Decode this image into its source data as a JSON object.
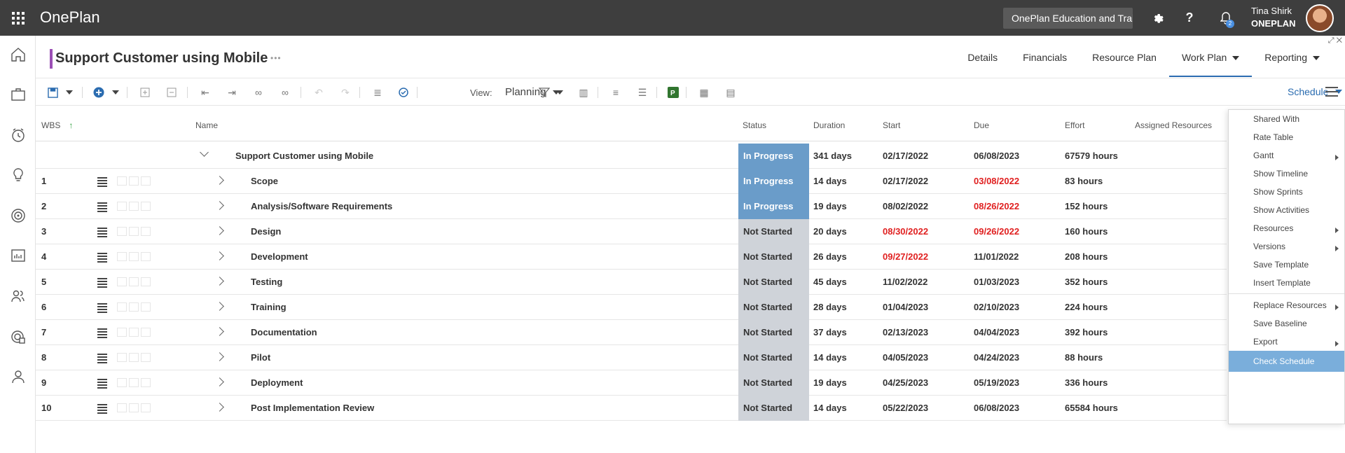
{
  "app": {
    "name": "OnePlan",
    "tenant": "OnePlan Education and Training"
  },
  "user": {
    "name": "Tina Shirk",
    "org": "ONEPLAN",
    "notification_count": "2"
  },
  "topbar": {
    "help_label": "?"
  },
  "page": {
    "title": "Support Customer using Mobile",
    "more": "•••"
  },
  "tabs": [
    {
      "label": "Details"
    },
    {
      "label": "Financials"
    },
    {
      "label": "Resource Plan"
    },
    {
      "label": "Work Plan",
      "active": true
    },
    {
      "label": "Reporting"
    }
  ],
  "toolbar": {
    "view_label": "View:",
    "view_value": "Planning",
    "schedule_label": "Schedule"
  },
  "columns": {
    "wbs": "WBS",
    "name": "Name",
    "status": "Status",
    "duration": "Duration",
    "start": "Start",
    "due": "Due",
    "effort": "Effort",
    "assigned": "Assigned Resources"
  },
  "summary": {
    "name": "Support Customer using Mobile",
    "status": "In Progress",
    "duration": "341 days",
    "start": "02/17/2022",
    "due": "06/08/2023",
    "effort": "67579 hours"
  },
  "rows": [
    {
      "wbs": "1",
      "name": "Scope",
      "status": "In Progress",
      "duration": "14 days",
      "start": "02/17/2022",
      "due": "03/08/2022",
      "effort": "83 hours"
    },
    {
      "wbs": "2",
      "name": "Analysis/Software Requirements",
      "status": "In Progress",
      "duration": "19 days",
      "start": "08/02/2022",
      "due": "08/26/2022",
      "effort": "152 hours"
    },
    {
      "wbs": "3",
      "name": "Design",
      "status": "Not Started",
      "duration": "20 days",
      "start": "08/30/2022",
      "due": "09/26/2022",
      "effort": "160 hours"
    },
    {
      "wbs": "4",
      "name": "Development",
      "status": "Not Started",
      "duration": "26 days",
      "start": "09/27/2022",
      "due": "11/01/2022",
      "effort": "208 hours"
    },
    {
      "wbs": "5",
      "name": "Testing",
      "status": "Not Started",
      "duration": "45 days",
      "start": "11/02/2022",
      "due": "01/03/2023",
      "effort": "352 hours"
    },
    {
      "wbs": "6",
      "name": "Training",
      "status": "Not Started",
      "duration": "28 days",
      "start": "01/04/2023",
      "due": "02/10/2023",
      "effort": "224 hours"
    },
    {
      "wbs": "7",
      "name": "Documentation",
      "status": "Not Started",
      "duration": "37 days",
      "start": "02/13/2023",
      "due": "04/04/2023",
      "effort": "392 hours"
    },
    {
      "wbs": "8",
      "name": "Pilot",
      "status": "Not Started",
      "duration": "14 days",
      "start": "04/05/2023",
      "due": "04/24/2023",
      "effort": "88 hours"
    },
    {
      "wbs": "9",
      "name": "Deployment",
      "status": "Not Started",
      "duration": "19 days",
      "start": "04/25/2023",
      "due": "05/19/2023",
      "effort": "336 hours"
    },
    {
      "wbs": "10",
      "name": "Post Implementation Review",
      "status": "Not Started",
      "duration": "14 days",
      "start": "05/22/2023",
      "due": "06/08/2023",
      "effort": "65584 hours"
    }
  ],
  "schedule_menu": [
    {
      "label": "Shared With"
    },
    {
      "label": "Rate Table"
    },
    {
      "label": "Gantt",
      "submenu": true
    },
    {
      "label": "Show Timeline"
    },
    {
      "label": "Show Sprints"
    },
    {
      "label": "Show Activities"
    },
    {
      "label": "Resources",
      "submenu": true
    },
    {
      "label": "Versions",
      "submenu": true
    },
    {
      "label": "Save Template"
    },
    {
      "label": "Insert Template"
    },
    {
      "label": "Replace Resources",
      "submenu": true
    },
    {
      "label": "Save Baseline"
    },
    {
      "label": "Export",
      "submenu": true
    },
    {
      "label": "Check Schedule",
      "active": true
    }
  ],
  "colors": {
    "topbar": "#3e3e3e",
    "accent": "#2b6cb0",
    "in_progress": "#6a9cc9",
    "not_started": "#cfd3d9",
    "overdue": "#e02020",
    "title_marker": "#9b4fb5"
  }
}
